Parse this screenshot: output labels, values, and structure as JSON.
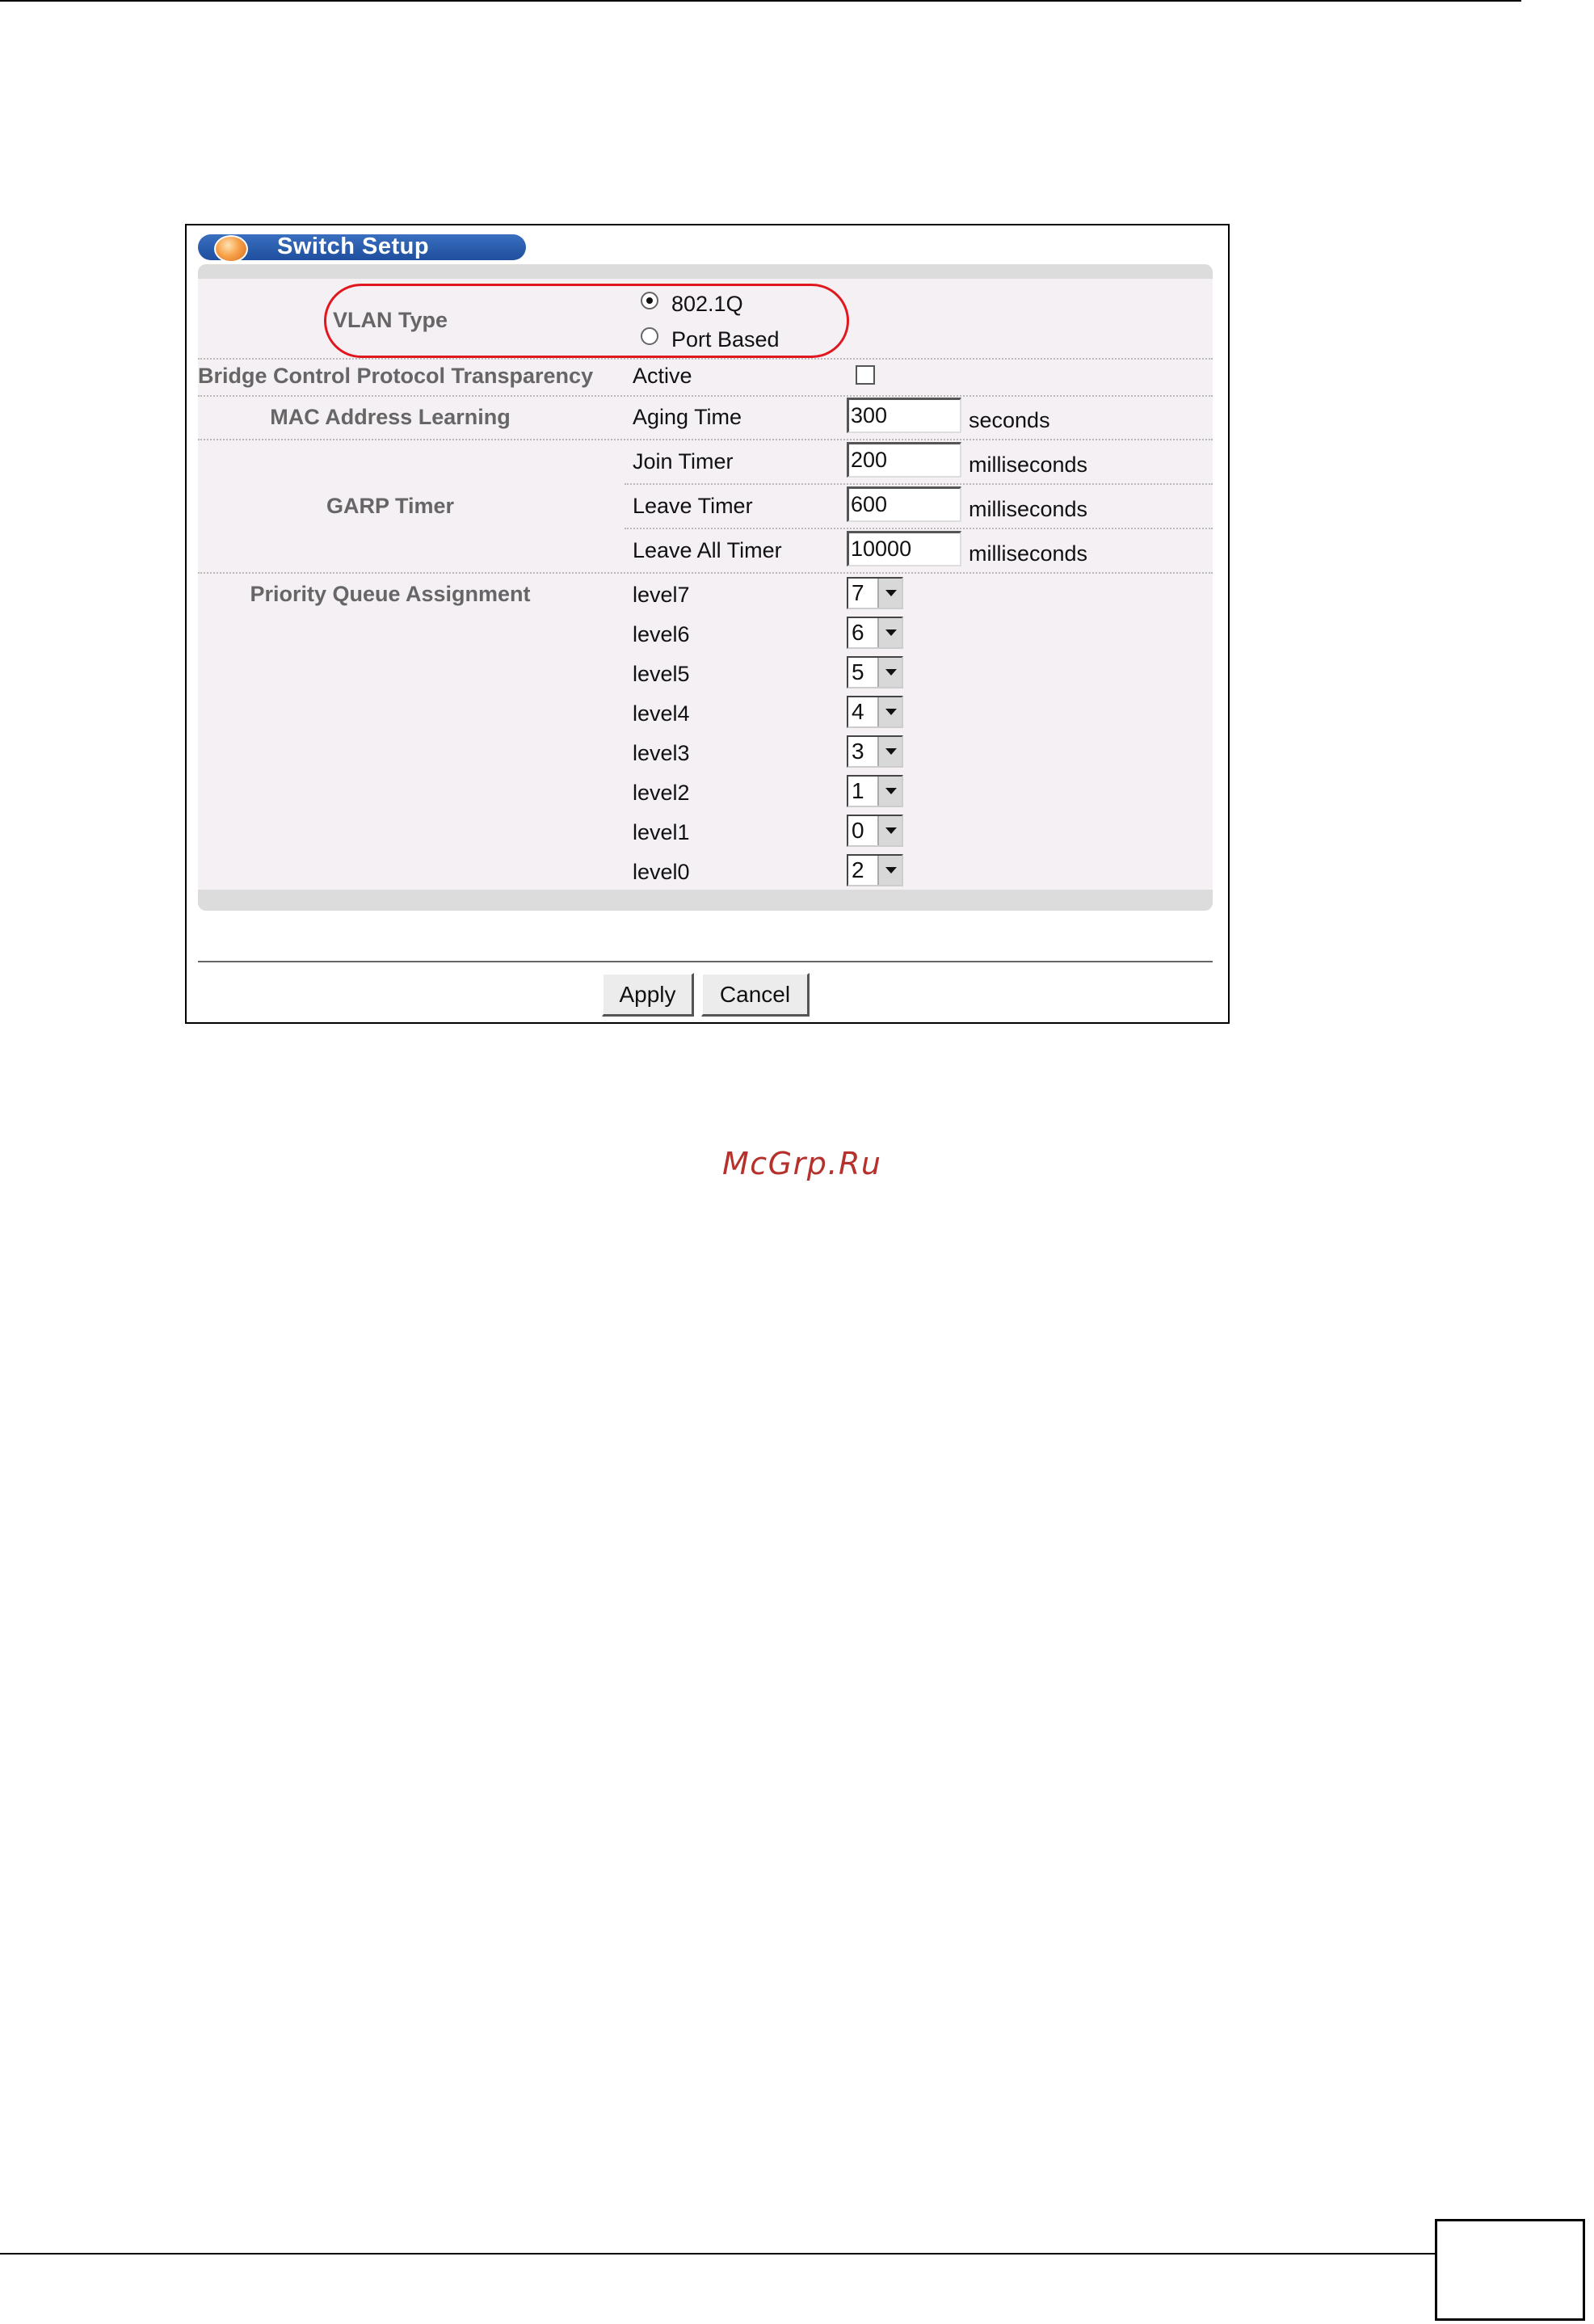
{
  "window": {
    "title": "Switch Setup"
  },
  "form": {
    "vlan_type": {
      "label": "VLAN Type",
      "options": [
        "802.1Q",
        "Port Based"
      ],
      "selected": "802.1Q"
    },
    "bridge_control": {
      "label": "Bridge Control Protocol Transparency",
      "field_label": "Active",
      "checked": false
    },
    "mac_learning": {
      "label": "MAC Address Learning",
      "field_label": "Aging Time",
      "value": "300",
      "unit": "seconds"
    },
    "garp_timer": {
      "label": "GARP Timer",
      "rows": [
        {
          "label": "Join Timer",
          "value": "200",
          "unit": "milliseconds"
        },
        {
          "label": "Leave Timer",
          "value": "600",
          "unit": "milliseconds"
        },
        {
          "label": "Leave All Timer",
          "value": "10000",
          "unit": "milliseconds"
        }
      ]
    },
    "priority_queue": {
      "label": "Priority Queue Assignment",
      "levels": [
        {
          "label": "level7",
          "value": "7"
        },
        {
          "label": "level6",
          "value": "6"
        },
        {
          "label": "level5",
          "value": "5"
        },
        {
          "label": "level4",
          "value": "4"
        },
        {
          "label": "level3",
          "value": "3"
        },
        {
          "label": "level2",
          "value": "1"
        },
        {
          "label": "level1",
          "value": "0"
        },
        {
          "label": "level0",
          "value": "2"
        }
      ]
    }
  },
  "buttons": {
    "apply": "Apply",
    "cancel": "Cancel"
  },
  "annotation": {
    "highlight_color": "#e0171f"
  },
  "watermark": "McGrp.Ru"
}
